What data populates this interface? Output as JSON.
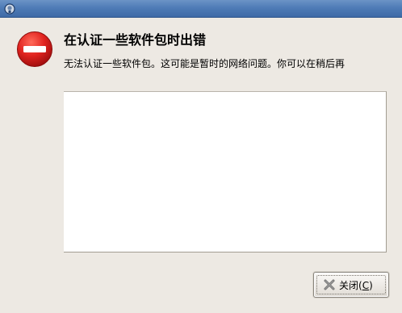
{
  "window": {
    "title": ""
  },
  "dialog": {
    "heading": "在认证一些软件包时出错",
    "message": "无法认证一些软件包。这可能是暂时的网络问题。你可以在稍后再",
    "icon": "error-icon"
  },
  "details": {
    "text": ""
  },
  "buttons": {
    "close_label_prefix": "关闭(",
    "close_mnemonic": "C",
    "close_label_suffix": ")",
    "close_icon": "close-x-icon"
  },
  "colors": {
    "error_red": "#d81e1e",
    "titlebar_blue": "#4f7cb7",
    "window_bg": "#ede9e3"
  }
}
